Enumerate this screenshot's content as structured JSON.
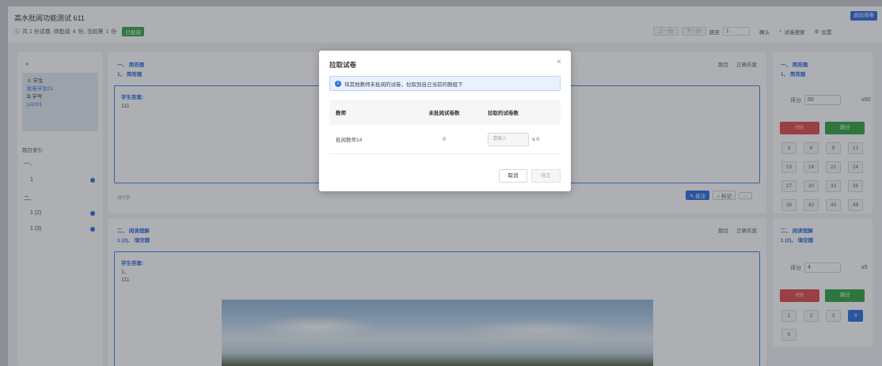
{
  "header": {
    "exam_title": "高水批阅功能测试 611",
    "summary": {
      "prefix": "共 1 份试卷, 待批阅",
      "pending": "4",
      "middle": "份, 当前第",
      "current": "1",
      "suffix": "份",
      "status_tag": "已批阅"
    },
    "exit_label": "退出阅卷",
    "pager": {
      "prev_label": "上一份",
      "next_label": "下一份",
      "goto_label": "跳至",
      "goto_value": "1",
      "confirm_label": "确认",
      "search_label": "试卷搜索",
      "settings_label": "设置"
    }
  },
  "left_panel": {
    "collapse_label": "«",
    "student_label": "学生",
    "student_name": "批卷学生01",
    "id_label": "学号",
    "student_id": "js1001",
    "nav_title": "题目索引",
    "groups": [
      {
        "label": "一、",
        "items": [
          "1"
        ]
      },
      {
        "label": "二、",
        "items": [
          "1 (2)",
          "1 (3)"
        ]
      }
    ]
  },
  "questions": [
    {
      "section": "一、 简答题",
      "sub": "1、 简答题",
      "links": [
        "题目",
        "正确答案"
      ],
      "answer_label": "学生答案:",
      "answer_text": "111",
      "footer_text": "共0字",
      "score_label": "评分",
      "score_value": "50",
      "max_score": "≤50",
      "zero_label": "0分",
      "full_label": "满分",
      "quick_scores": [
        "3",
        "6",
        "9",
        "12",
        "15",
        "18",
        "21",
        "24",
        "27",
        "30",
        "33",
        "36",
        "39",
        "42",
        "45",
        "48"
      ],
      "actions": {
        "annotate": "批注",
        "mark": "标记",
        "more": "…"
      }
    },
    {
      "section": "二、 阅读理解",
      "sub": "1 (2)、 填空题",
      "links": [
        "题目",
        "正确答案"
      ],
      "answer_label": "学生答案:",
      "answer_line1": "1、",
      "answer_text": "111",
      "score_label": "评分",
      "score_value": "4",
      "max_score": "≤5",
      "zero_label": "0分",
      "full_label": "满分",
      "quick_scores": [
        "1",
        "2",
        "3",
        "4",
        "5"
      ],
      "selected_score": "4"
    }
  ],
  "modal": {
    "title": "拉取试卷",
    "close_icon": "×",
    "info_text": "将其他教师未批阅的试卷，拉取到自己当前的题组下",
    "table": {
      "headers": [
        "教师",
        "未批阅试卷数",
        "拉取的试卷数"
      ],
      "rows": [
        {
          "teacher": "批阅教师14",
          "unread": "0",
          "placeholder": "请输入",
          "suffix": "≤ 0"
        }
      ]
    },
    "cancel_label": "取消",
    "ok_label": "确定"
  },
  "colors": {
    "accent": "#2f6fe0",
    "danger": "#e04b4b",
    "success": "#35a345"
  }
}
